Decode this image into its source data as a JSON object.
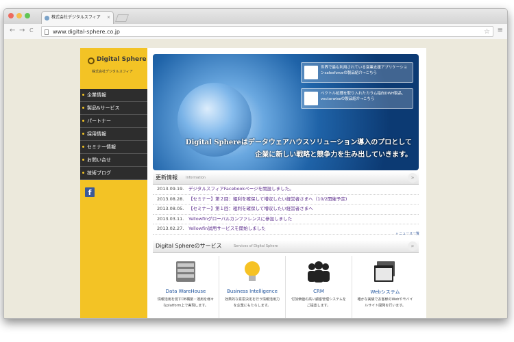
{
  "browser": {
    "tab_title": "株式会社デジタルスフィア",
    "tab_close": "×",
    "url": "www.digital-sphere.co.jp",
    "back_icon": "←",
    "forward_icon": "→",
    "reload_icon": "C",
    "star_icon": "☆",
    "menu_icon": "≡"
  },
  "brand": {
    "name": "Digital Sphere",
    "subtitle": "株式会社デジタルスフィア"
  },
  "sidebar": {
    "items": [
      {
        "label": "企業情報"
      },
      {
        "label": "製品&サービス"
      },
      {
        "label": "パートナー"
      },
      {
        "label": "採用情報"
      },
      {
        "label": "セミナー情報"
      },
      {
        "label": "お問い合せ"
      },
      {
        "label": "技術ブログ"
      }
    ],
    "facebook_glyph": "f"
  },
  "hero": {
    "card1": "世界で最も利用されている営業支援アプリケーションsalesforceの製品紹介→こちら",
    "card2": "ベクトル処理を取り入れたカラム指向DWH製品、vectorwiseの製品紹介→こちら",
    "headline1": "Digital Sphereはデータウェアハウスソリューション導入のプロとして",
    "headline2": "企業に新しい戦略と競争力を生み出していきます。"
  },
  "news": {
    "title": "更新情報",
    "subtitle": "Information",
    "items": [
      {
        "date": "2013.09.19.",
        "title": "デジタルスフィアFacebookページを開設しました。"
      },
      {
        "date": "2013.08.28.",
        "title": "【セミナー】第２回：粗利を確保して増収したい経営者さまへ（10/2開催予定)"
      },
      {
        "date": "2013.08.05.",
        "title": "【セミナー】第１回：粗利を確保して増収したい経営者さまへ"
      },
      {
        "date": "2013.03.11.",
        "title": "Yellowfinグローバルカンファレンスに参加しました"
      },
      {
        "date": "2013.02.27.",
        "title": "Yellowfin試用サービスを開始しました"
      }
    ],
    "more": "» ニュース一覧"
  },
  "services": {
    "title": "Digital Sphereのサービス",
    "subtitle": "Services of Digital Sphere",
    "items": [
      {
        "label": "Data WareHouse",
        "desc": "情報活用を促すDB構築・運用を様々なplatform上で実現します。",
        "icon": "database-icon"
      },
      {
        "label": "Business Intelligence",
        "desc": "効果的な意思決定を行う情報活用力を企業にもたらします。",
        "icon": "lightbulb-icon"
      },
      {
        "label": "CRM",
        "desc": "付加価値の高い顧客管理システムをご提案します。",
        "icon": "people-icon"
      },
      {
        "label": "Webシステム",
        "desc": "確かな実績でお客様のWebやモバイルサイト開発を行います。",
        "icon": "browser-window-icon"
      }
    ]
  },
  "colors": {
    "sidebar_bg": "#f3c325",
    "nav_bg": "#2d2d2d",
    "link": "#5a2a8a",
    "accent_blue": "#1a4f9a"
  }
}
